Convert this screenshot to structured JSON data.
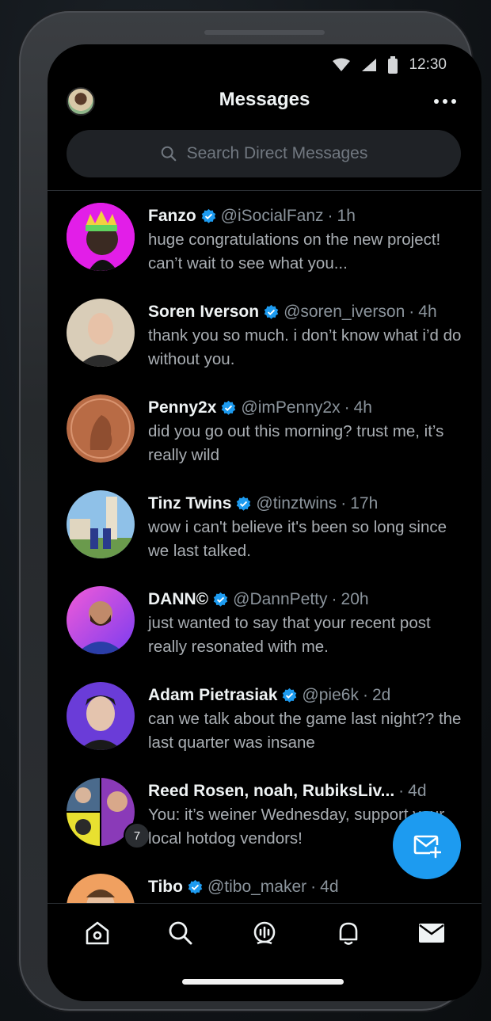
{
  "status_bar": {
    "time": "12:30"
  },
  "header": {
    "title": "Messages"
  },
  "search": {
    "placeholder": "Search Direct Messages"
  },
  "conversations": [
    {
      "name": "Fanzo",
      "handle": "@iSocialFanz",
      "time": "1h",
      "verified": true,
      "preview": "huge congratulations on the new project! can’t wait to see what you..."
    },
    {
      "name": "Soren Iverson",
      "handle": "@soren_iverson",
      "time": "4h",
      "verified": true,
      "preview": "thank you so much. i don’t know what i’d do without you."
    },
    {
      "name": "Penny2x",
      "handle": "@imPenny2x",
      "time": "4h",
      "verified": true,
      "preview": "did you go out this morning? trust me, it’s really wild"
    },
    {
      "name": "Tinz Twins",
      "handle": "@tinztwins",
      "time": "17h",
      "verified": true,
      "preview": "wow i can't believe it's been so long since we last talked."
    },
    {
      "name": "DANN©",
      "handle": "@DannPetty",
      "time": "20h",
      "verified": true,
      "preview": "just wanted to say that your recent post really resonated with me."
    },
    {
      "name": "Adam Pietrasiak",
      "handle": "@pie6k",
      "time": "2d",
      "verified": true,
      "preview": "can we talk about the game last night?? the last quarter was insane"
    },
    {
      "name": "Reed Rosen, noah, RubiksLiv...",
      "handle": "",
      "time": "4d",
      "verified": false,
      "preview": "You: it’s weiner Wednesday, support your local hotdog vendors!",
      "group_count": "7"
    },
    {
      "name": "Tibo",
      "handle": "@tibo_maker",
      "time": "4d",
      "verified": true,
      "preview": ""
    }
  ],
  "separator": "·",
  "bottom_nav": [
    "home-icon",
    "search-icon",
    "spaces-icon",
    "bell-icon",
    "mail-icon"
  ],
  "colors": {
    "accent": "#1d9bf0",
    "background": "#000000",
    "verified": "#1d9bf0"
  }
}
